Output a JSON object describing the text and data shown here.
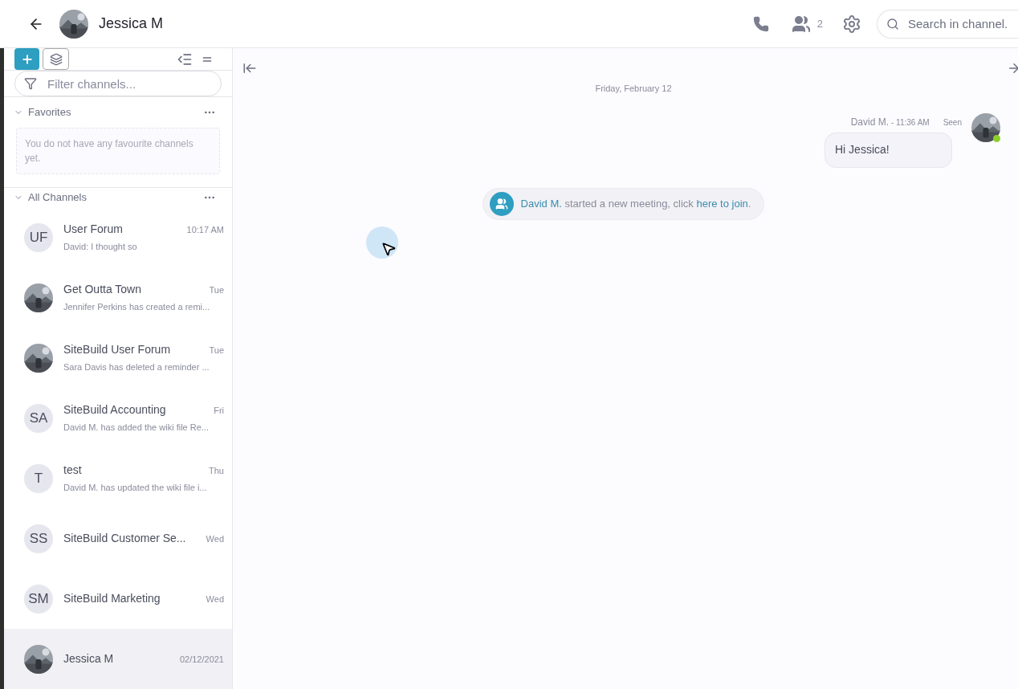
{
  "header": {
    "title": "Jessica M",
    "members_count": "2",
    "search": {
      "placeholder": "Search in channel."
    }
  },
  "sidebar": {
    "filter": {
      "placeholder": "Filter channels..."
    },
    "sections": [
      {
        "title": "Favorites",
        "expanded": true,
        "empty_text": "You do not have any favourite channels yet."
      },
      {
        "title": "All Channels",
        "expanded": true
      }
    ],
    "channels": [
      {
        "name": "User Forum",
        "time": "10:17 AM",
        "preview": "David: I thought so",
        "avatar": {
          "kind": "initials",
          "text": "UF"
        },
        "selected": false
      },
      {
        "name": "Get Outta Town",
        "time": "Tue",
        "preview": "Jennifer Perkins has created a remi...",
        "selected": false
      },
      {
        "name": "SiteBuild User Forum",
        "time": "Tue",
        "preview": "Sara Davis has deleted a reminder ...",
        "selected": false
      },
      {
        "name": "SiteBuild Accounting",
        "time": "Fri",
        "preview": "David M. has added the wiki file Re...",
        "avatar": {
          "kind": "initials",
          "text": "SA"
        },
        "selected": false
      },
      {
        "name": "test",
        "time": "Thu",
        "preview": "David M. has updated the wiki file i...",
        "avatar": {
          "kind": "initials",
          "text": "T"
        },
        "selected": false
      },
      {
        "name": "SiteBuild Customer Se...",
        "time": "Wed",
        "avatar": {
          "kind": "initials",
          "text": "SS"
        },
        "selected": false
      },
      {
        "name": "SiteBuild Marketing",
        "time": "Wed",
        "avatar": {
          "kind": "initials",
          "text": "SM"
        },
        "selected": false
      },
      {
        "name": "Jessica M",
        "time": "02/12/2021",
        "selected": true
      }
    ]
  },
  "chat": {
    "date": "Friday, February 12",
    "messages": [
      {
        "kind": "message",
        "author": "David M.",
        "time": "- 11:36 AM",
        "status": "Seen",
        "text": "Hi Jessica!",
        "online": true
      },
      {
        "kind": "event",
        "author": "David M.",
        "text": " started a new meeting, click ",
        "link": "here to join",
        "end": "."
      }
    ]
  }
}
